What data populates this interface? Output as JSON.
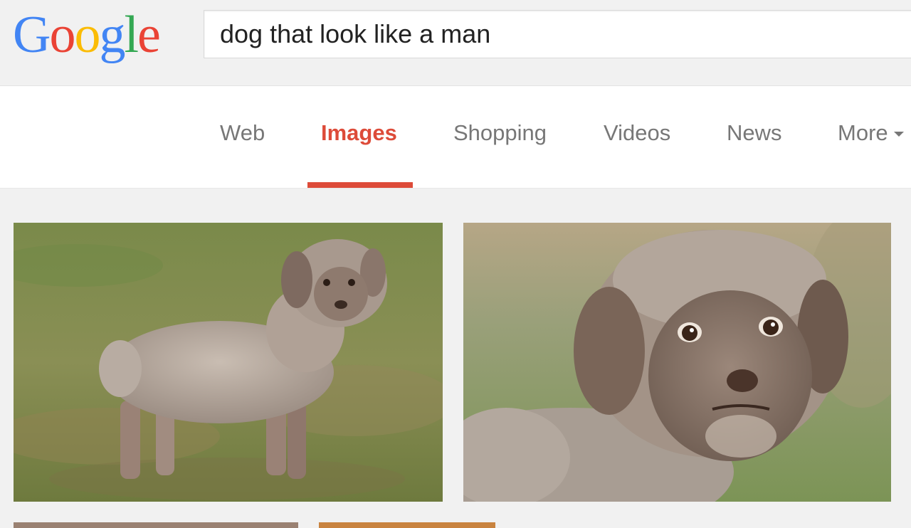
{
  "logo": {
    "letters": [
      {
        "char": "G",
        "color": "#4285f4"
      },
      {
        "char": "o",
        "color": "#ea4335"
      },
      {
        "char": "o",
        "color": "#fbbc05"
      },
      {
        "char": "g",
        "color": "#4285f4"
      },
      {
        "char": "l",
        "color": "#34a853"
      },
      {
        "char": "e",
        "color": "#ea4335"
      }
    ]
  },
  "search": {
    "query": "dog that look like a man"
  },
  "tabs": {
    "web": "Web",
    "images": "Images",
    "shopping": "Shopping",
    "videos": "Videos",
    "news": "News",
    "more": "More",
    "active": "images"
  },
  "colors": {
    "accent": "#dd4b39",
    "tab_text": "#777777",
    "background": "#f1f1f1"
  },
  "results": {
    "images": [
      {
        "subject": "poodle-mix dog standing sideways on grass, human-like face"
      },
      {
        "subject": "close-up of shaggy grey dog with human-like face"
      },
      {
        "subject": "partially visible result"
      },
      {
        "subject": "partially visible result"
      }
    ]
  }
}
